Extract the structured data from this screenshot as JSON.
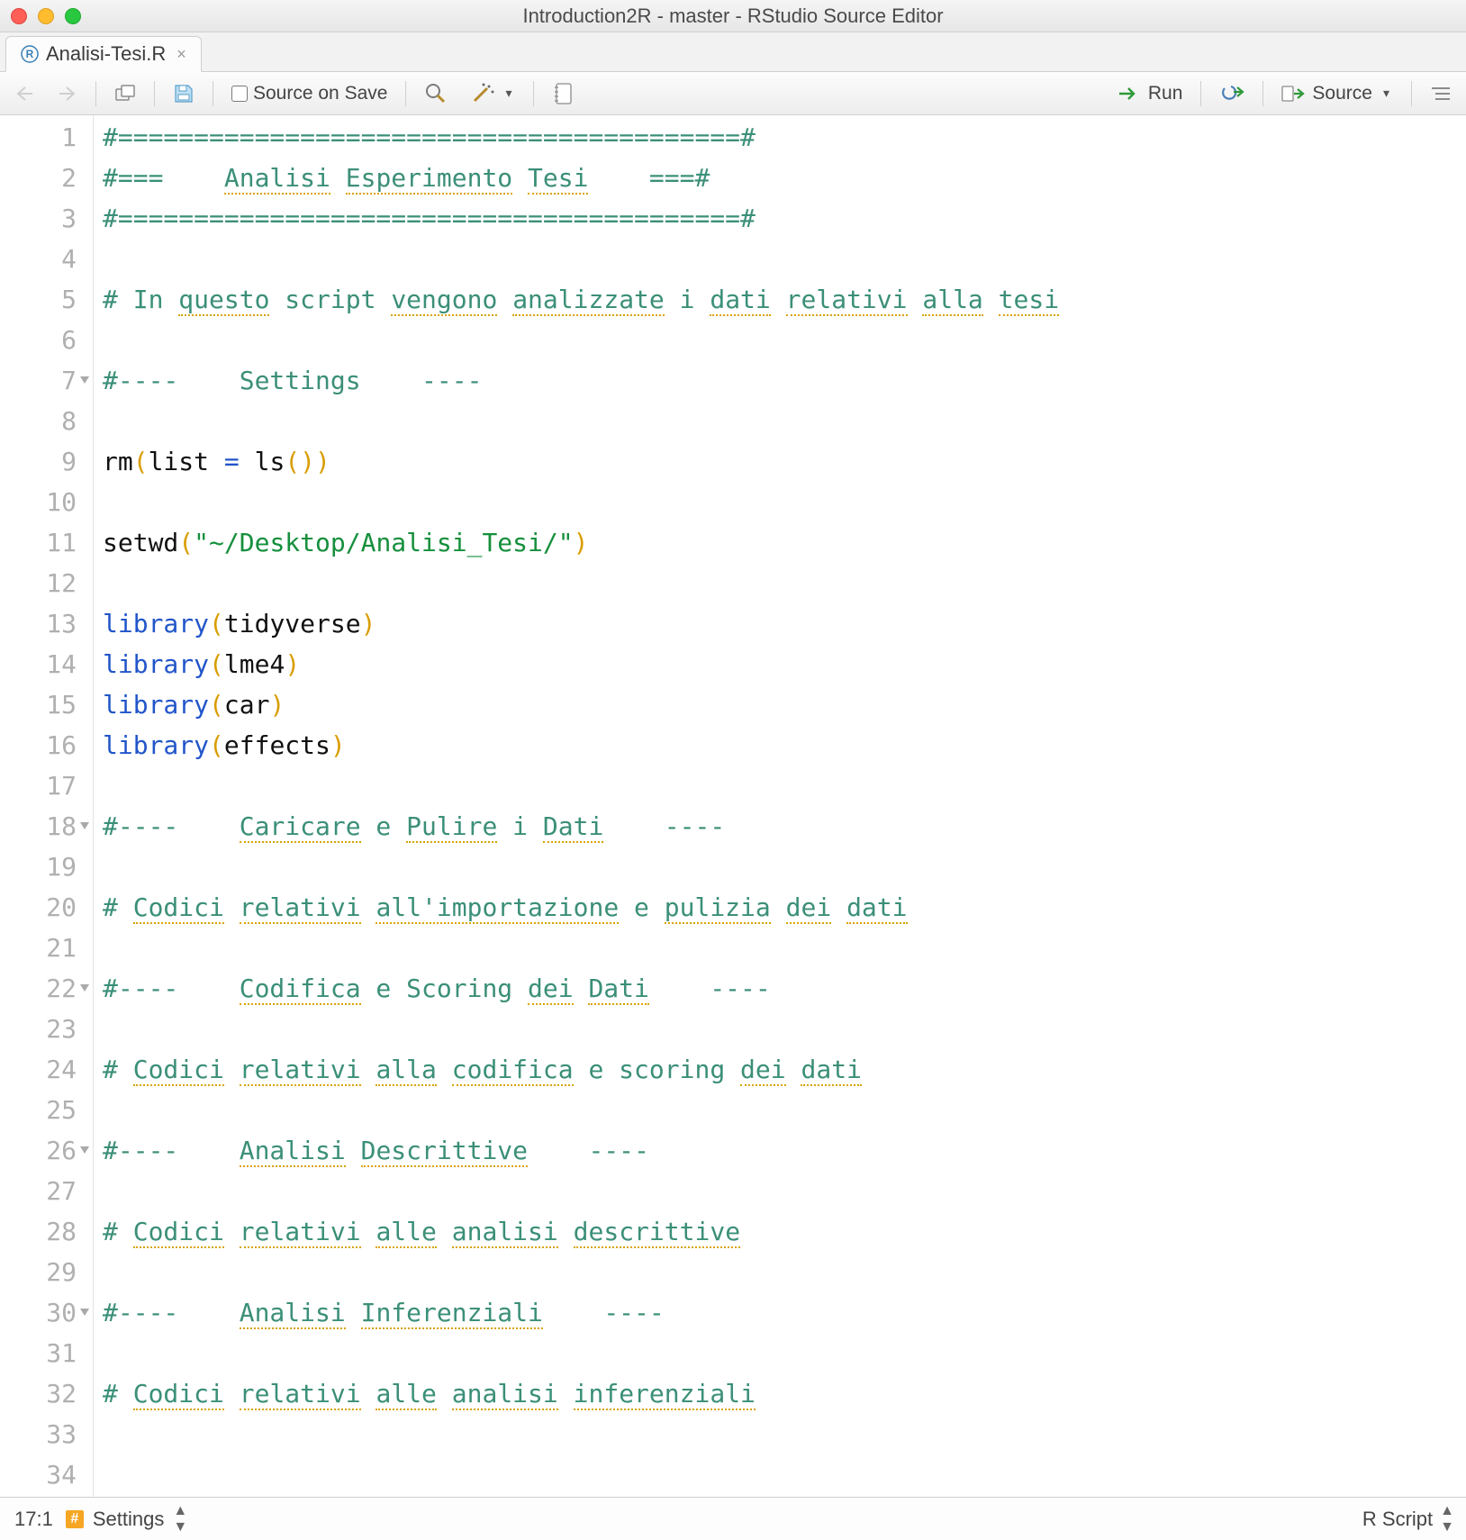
{
  "window": {
    "title": "Introduction2R - master - RStudio Source Editor"
  },
  "tab": {
    "filename": "Analisi-Tesi.R"
  },
  "toolbar": {
    "source_on_save": "Source on Save",
    "run": "Run",
    "source": "Source"
  },
  "status": {
    "pos": "17:1",
    "section": "Settings",
    "filetype": "R Script"
  },
  "code": {
    "lines": [
      {
        "n": 1,
        "fold": false,
        "tokens": [
          {
            "t": "comment",
            "v": "#=========================================#"
          }
        ]
      },
      {
        "n": 2,
        "fold": false,
        "tokens": [
          {
            "t": "comment",
            "v": "#===    "
          },
          {
            "t": "comment-spell",
            "v": "Analisi"
          },
          {
            "t": "comment",
            "v": " "
          },
          {
            "t": "comment-spell",
            "v": "Esperimento"
          },
          {
            "t": "comment",
            "v": " "
          },
          {
            "t": "comment-spell",
            "v": "Tesi"
          },
          {
            "t": "comment",
            "v": "    ===#"
          }
        ]
      },
      {
        "n": 3,
        "fold": false,
        "tokens": [
          {
            "t": "comment",
            "v": "#=========================================#"
          }
        ]
      },
      {
        "n": 4,
        "fold": false,
        "tokens": []
      },
      {
        "n": 5,
        "fold": false,
        "tokens": [
          {
            "t": "comment",
            "v": "# In "
          },
          {
            "t": "comment-spell",
            "v": "questo"
          },
          {
            "t": "comment",
            "v": " script "
          },
          {
            "t": "comment-spell",
            "v": "vengono"
          },
          {
            "t": "comment",
            "v": " "
          },
          {
            "t": "comment-spell",
            "v": "analizzate"
          },
          {
            "t": "comment",
            "v": " i "
          },
          {
            "t": "comment-spell",
            "v": "dati"
          },
          {
            "t": "comment",
            "v": " "
          },
          {
            "t": "comment-spell",
            "v": "relativi"
          },
          {
            "t": "comment",
            "v": " "
          },
          {
            "t": "comment-spell",
            "v": "alla"
          },
          {
            "t": "comment",
            "v": " "
          },
          {
            "t": "comment-spell",
            "v": "tesi"
          }
        ]
      },
      {
        "n": 6,
        "fold": false,
        "tokens": []
      },
      {
        "n": 7,
        "fold": true,
        "tokens": [
          {
            "t": "comment",
            "v": "#----    Settings    ----"
          }
        ]
      },
      {
        "n": 8,
        "fold": false,
        "tokens": []
      },
      {
        "n": 9,
        "fold": false,
        "tokens": [
          {
            "t": "fn",
            "v": "rm"
          },
          {
            "t": "paren",
            "v": "("
          },
          {
            "t": "text",
            "v": "list "
          },
          {
            "t": "kw",
            "v": "="
          },
          {
            "t": "text",
            "v": " "
          },
          {
            "t": "fn",
            "v": "ls"
          },
          {
            "t": "paren",
            "v": "()"
          },
          {
            "t": "paren",
            "v": ")"
          }
        ]
      },
      {
        "n": 10,
        "fold": false,
        "tokens": []
      },
      {
        "n": 11,
        "fold": false,
        "tokens": [
          {
            "t": "fn",
            "v": "setwd"
          },
          {
            "t": "paren",
            "v": "("
          },
          {
            "t": "str",
            "v": "\"~/Desktop/Analisi_Tesi/\""
          },
          {
            "t": "paren",
            "v": ")"
          }
        ]
      },
      {
        "n": 12,
        "fold": false,
        "tokens": []
      },
      {
        "n": 13,
        "fold": false,
        "tokens": [
          {
            "t": "kw",
            "v": "library"
          },
          {
            "t": "paren",
            "v": "("
          },
          {
            "t": "text",
            "v": "tidyverse"
          },
          {
            "t": "paren",
            "v": ")"
          }
        ]
      },
      {
        "n": 14,
        "fold": false,
        "tokens": [
          {
            "t": "kw",
            "v": "library"
          },
          {
            "t": "paren",
            "v": "("
          },
          {
            "t": "text",
            "v": "lme4"
          },
          {
            "t": "paren",
            "v": ")"
          }
        ]
      },
      {
        "n": 15,
        "fold": false,
        "tokens": [
          {
            "t": "kw",
            "v": "library"
          },
          {
            "t": "paren",
            "v": "("
          },
          {
            "t": "text",
            "v": "car"
          },
          {
            "t": "paren",
            "v": ")"
          }
        ]
      },
      {
        "n": 16,
        "fold": false,
        "tokens": [
          {
            "t": "kw",
            "v": "library"
          },
          {
            "t": "paren",
            "v": "("
          },
          {
            "t": "text",
            "v": "effects"
          },
          {
            "t": "paren",
            "v": ")"
          }
        ]
      },
      {
        "n": 17,
        "fold": false,
        "tokens": []
      },
      {
        "n": 18,
        "fold": true,
        "tokens": [
          {
            "t": "comment",
            "v": "#----    "
          },
          {
            "t": "comment-spell",
            "v": "Caricare"
          },
          {
            "t": "comment",
            "v": " e "
          },
          {
            "t": "comment-spell",
            "v": "Pulire"
          },
          {
            "t": "comment",
            "v": " i "
          },
          {
            "t": "comment-spell",
            "v": "Dati"
          },
          {
            "t": "comment",
            "v": "    ----"
          }
        ]
      },
      {
        "n": 19,
        "fold": false,
        "tokens": []
      },
      {
        "n": 20,
        "fold": false,
        "tokens": [
          {
            "t": "comment",
            "v": "# "
          },
          {
            "t": "comment-spell",
            "v": "Codici"
          },
          {
            "t": "comment",
            "v": " "
          },
          {
            "t": "comment-spell",
            "v": "relativi"
          },
          {
            "t": "comment",
            "v": " "
          },
          {
            "t": "comment-spell",
            "v": "all'importazione"
          },
          {
            "t": "comment",
            "v": " e "
          },
          {
            "t": "comment-spell",
            "v": "pulizia"
          },
          {
            "t": "comment",
            "v": " "
          },
          {
            "t": "comment-spell",
            "v": "dei"
          },
          {
            "t": "comment",
            "v": " "
          },
          {
            "t": "comment-spell",
            "v": "dati"
          }
        ]
      },
      {
        "n": 21,
        "fold": false,
        "tokens": []
      },
      {
        "n": 22,
        "fold": true,
        "tokens": [
          {
            "t": "comment",
            "v": "#----    "
          },
          {
            "t": "comment-spell",
            "v": "Codifica"
          },
          {
            "t": "comment",
            "v": " e Scoring "
          },
          {
            "t": "comment-spell",
            "v": "dei"
          },
          {
            "t": "comment",
            "v": " "
          },
          {
            "t": "comment-spell",
            "v": "Dati"
          },
          {
            "t": "comment",
            "v": "    ----"
          }
        ]
      },
      {
        "n": 23,
        "fold": false,
        "tokens": []
      },
      {
        "n": 24,
        "fold": false,
        "tokens": [
          {
            "t": "comment",
            "v": "# "
          },
          {
            "t": "comment-spell",
            "v": "Codici"
          },
          {
            "t": "comment",
            "v": " "
          },
          {
            "t": "comment-spell",
            "v": "relativi"
          },
          {
            "t": "comment",
            "v": " "
          },
          {
            "t": "comment-spell",
            "v": "alla"
          },
          {
            "t": "comment",
            "v": " "
          },
          {
            "t": "comment-spell",
            "v": "codifica"
          },
          {
            "t": "comment",
            "v": " e scoring "
          },
          {
            "t": "comment-spell",
            "v": "dei"
          },
          {
            "t": "comment",
            "v": " "
          },
          {
            "t": "comment-spell",
            "v": "dati"
          }
        ]
      },
      {
        "n": 25,
        "fold": false,
        "tokens": []
      },
      {
        "n": 26,
        "fold": true,
        "tokens": [
          {
            "t": "comment",
            "v": "#----    "
          },
          {
            "t": "comment-spell",
            "v": "Analisi"
          },
          {
            "t": "comment",
            "v": " "
          },
          {
            "t": "comment-spell",
            "v": "Descrittive"
          },
          {
            "t": "comment",
            "v": "    ----"
          }
        ]
      },
      {
        "n": 27,
        "fold": false,
        "tokens": []
      },
      {
        "n": 28,
        "fold": false,
        "tokens": [
          {
            "t": "comment",
            "v": "# "
          },
          {
            "t": "comment-spell",
            "v": "Codici"
          },
          {
            "t": "comment",
            "v": " "
          },
          {
            "t": "comment-spell",
            "v": "relativi"
          },
          {
            "t": "comment",
            "v": " "
          },
          {
            "t": "comment-spell",
            "v": "alle"
          },
          {
            "t": "comment",
            "v": " "
          },
          {
            "t": "comment-spell",
            "v": "analisi"
          },
          {
            "t": "comment",
            "v": " "
          },
          {
            "t": "comment-spell",
            "v": "descrittive"
          }
        ]
      },
      {
        "n": 29,
        "fold": false,
        "tokens": []
      },
      {
        "n": 30,
        "fold": true,
        "tokens": [
          {
            "t": "comment",
            "v": "#----    "
          },
          {
            "t": "comment-spell",
            "v": "Analisi"
          },
          {
            "t": "comment",
            "v": " "
          },
          {
            "t": "comment-spell",
            "v": "Inferenziali"
          },
          {
            "t": "comment",
            "v": "    ----"
          }
        ]
      },
      {
        "n": 31,
        "fold": false,
        "tokens": []
      },
      {
        "n": 32,
        "fold": false,
        "tokens": [
          {
            "t": "comment",
            "v": "# "
          },
          {
            "t": "comment-spell",
            "v": "Codici"
          },
          {
            "t": "comment",
            "v": " "
          },
          {
            "t": "comment-spell",
            "v": "relativi"
          },
          {
            "t": "comment",
            "v": " "
          },
          {
            "t": "comment-spell",
            "v": "alle"
          },
          {
            "t": "comment",
            "v": " "
          },
          {
            "t": "comment-spell",
            "v": "analisi"
          },
          {
            "t": "comment",
            "v": " "
          },
          {
            "t": "comment-spell",
            "v": "inferenziali"
          }
        ]
      },
      {
        "n": 33,
        "fold": false,
        "tokens": []
      },
      {
        "n": 34,
        "fold": false,
        "tokens": []
      }
    ]
  }
}
